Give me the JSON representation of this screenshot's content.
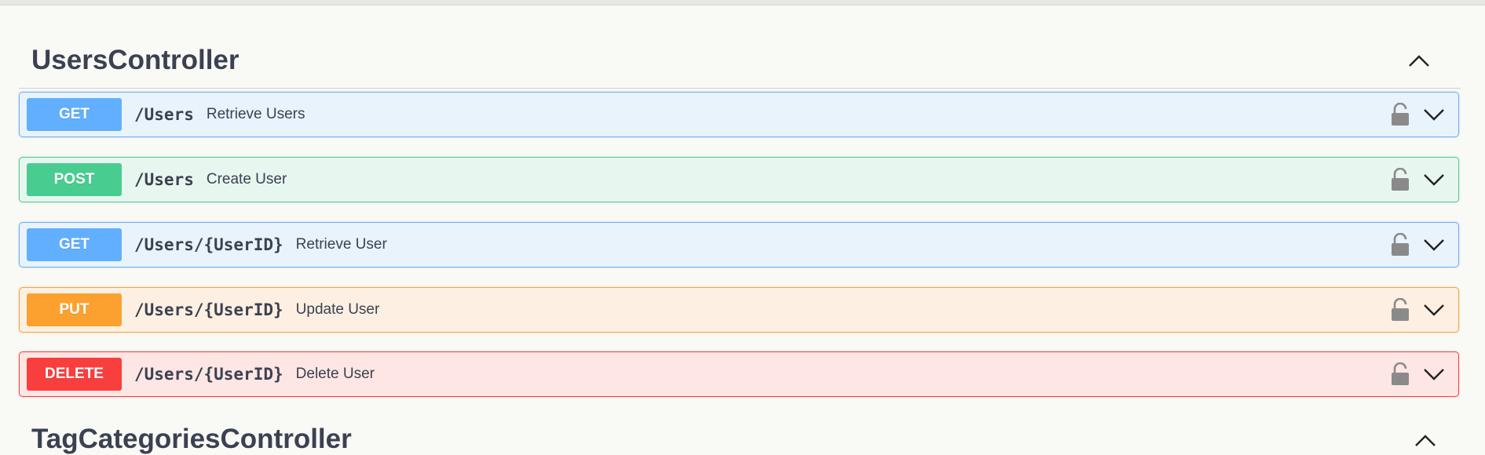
{
  "section": {
    "title": "UsersController"
  },
  "operations": [
    {
      "method": "GET",
      "path": "/Users",
      "summary": "Retrieve Users",
      "badge_color": "#61affe",
      "bg_color": "#e8f3fb",
      "border_color": "#61affe"
    },
    {
      "method": "POST",
      "path": "/Users",
      "summary": "Create User",
      "badge_color": "#49cc90",
      "bg_color": "#e8f6f0",
      "border_color": "#49cc90"
    },
    {
      "method": "GET",
      "path": "/Users/{UserID}",
      "summary": "Retrieve User",
      "badge_color": "#61affe",
      "bg_color": "#e8f3fb",
      "border_color": "#61affe"
    },
    {
      "method": "PUT",
      "path": "/Users/{UserID}",
      "summary": "Update User",
      "badge_color": "#fca130",
      "bg_color": "#fdf0e2",
      "border_color": "#fca130"
    },
    {
      "method": "DELETE",
      "path": "/Users/{UserID}",
      "summary": "Delete User",
      "badge_color": "#f93e3e",
      "bg_color": "#fde6e3",
      "border_color": "#f93e3e"
    }
  ],
  "next_section": {
    "title": "TagCategoriesController"
  },
  "icons": {
    "section_toggle": "chevron-up-icon",
    "operation_lock": "unlocked-padlock-icon",
    "operation_toggle": "chevron-down-icon"
  }
}
